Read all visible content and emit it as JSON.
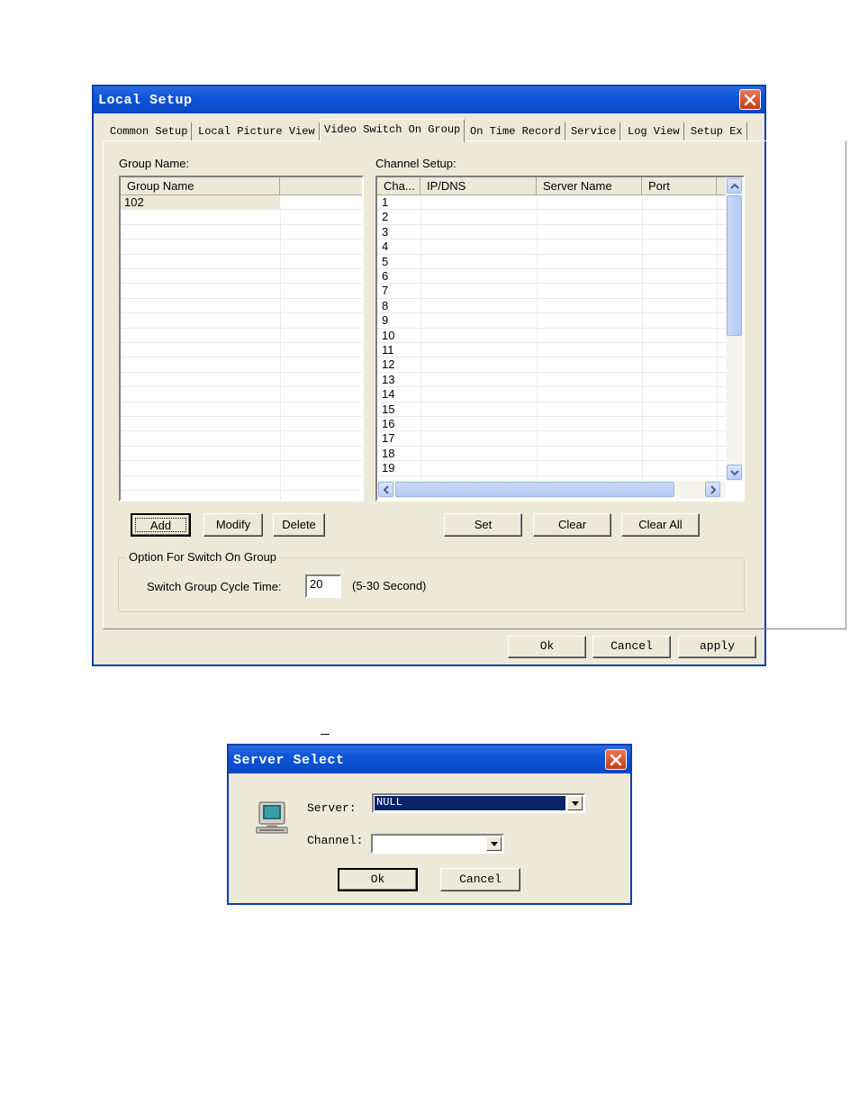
{
  "local_setup": {
    "title": "Local Setup",
    "tabs": [
      "Common Setup",
      "Local Picture View",
      "Video Switch On Group",
      "On Time Record",
      "Service",
      "Log View",
      "Setup Ex"
    ],
    "active_tab": "Video Switch On Group",
    "group_label": "Group Name:",
    "channel_label": "Channel Setup:",
    "group_list": {
      "headers": [
        "Group Name",
        ""
      ],
      "rows": [
        "102"
      ]
    },
    "channel_list": {
      "headers": [
        "Cha...",
        "IP/DNS",
        "Server Name",
        "Port"
      ],
      "rows": [
        "1",
        "2",
        "3",
        "4",
        "5",
        "6",
        "7",
        "8",
        "9",
        "10",
        "11",
        "12",
        "13",
        "14",
        "15",
        "16",
        "17",
        "18",
        "19"
      ]
    },
    "buttons": {
      "add": "Add",
      "modify": "Modify",
      "delete": "Delete",
      "set": "Set",
      "clear": "Clear",
      "clear_all": "Clear All"
    },
    "option_group": {
      "legend": "Option For Switch On Group",
      "cycle_label": "Switch Group Cycle Time:",
      "cycle_value": "20",
      "cycle_hint": "(5-30 Second)"
    },
    "footer": {
      "ok": "Ok",
      "cancel": "Cancel",
      "apply": "apply"
    }
  },
  "server_select": {
    "title": "Server Select",
    "server_label": "Server:",
    "server_value": "NULL",
    "channel_label": "Channel:",
    "channel_value": "",
    "ok": "Ok",
    "cancel": "Cancel"
  },
  "colors": {
    "title_bar": "#0a48c4",
    "window_bg": "#ece9d8",
    "close_button": "#c43b16",
    "selection": "#0a246a"
  }
}
